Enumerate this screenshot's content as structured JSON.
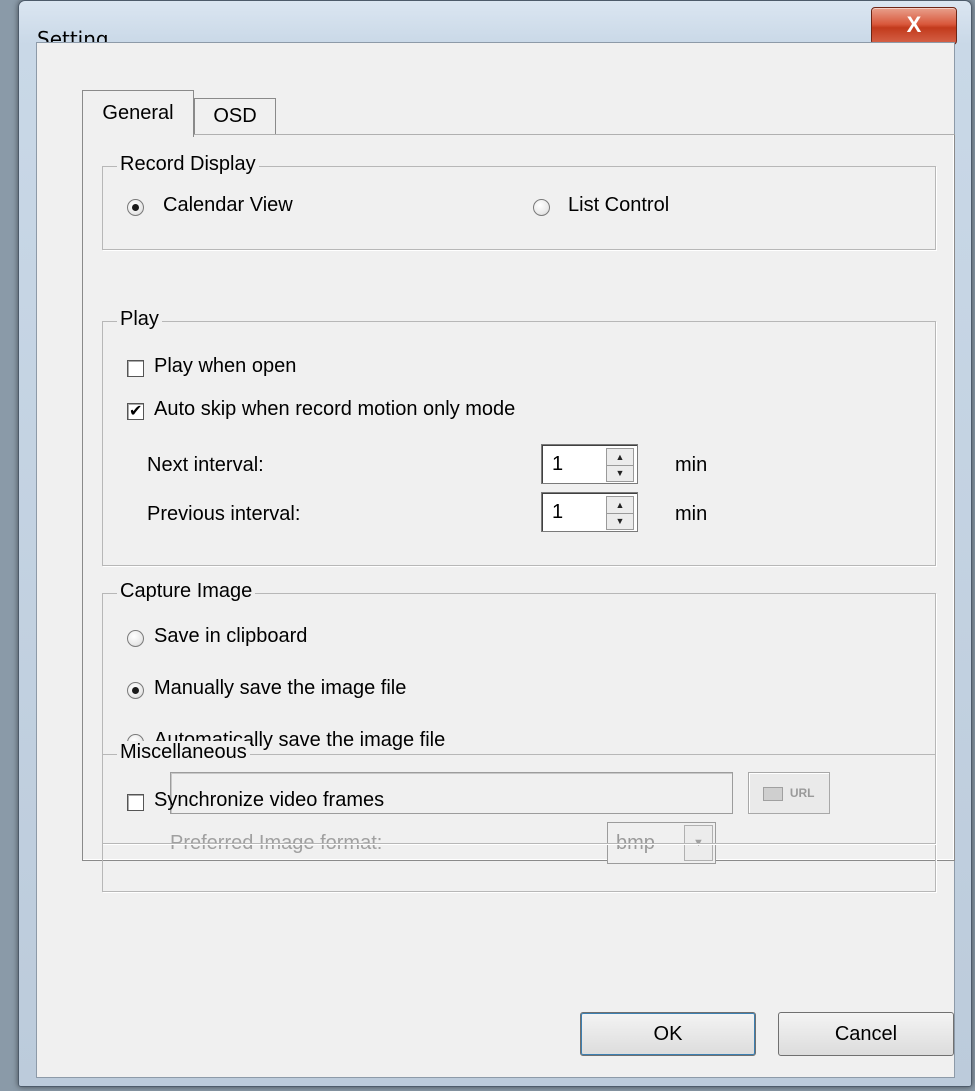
{
  "window": {
    "title": "Setting",
    "close_label": "X"
  },
  "tabs": [
    {
      "label": "General",
      "selected": true
    },
    {
      "label": "OSD",
      "selected": false
    }
  ],
  "record_display": {
    "title": "Record Display",
    "options": [
      {
        "label": "Calendar View",
        "checked": true
      },
      {
        "label": "List Control",
        "checked": false
      }
    ]
  },
  "play": {
    "title": "Play",
    "play_when_open": {
      "label": "Play when open",
      "checked": false
    },
    "auto_skip": {
      "label": "Auto skip when record motion only mode",
      "checked": true
    },
    "next_interval": {
      "label": "Next interval:",
      "value": "1",
      "unit": "min"
    },
    "previous_interval": {
      "label": "Previous interval:",
      "value": "1",
      "unit": "min"
    }
  },
  "capture_image": {
    "title": "Capture Image",
    "options": [
      {
        "label": "Save in clipboard",
        "checked": false
      },
      {
        "label": "Manually save the image file",
        "checked": true
      },
      {
        "label": "Automatically save the image file",
        "checked": false
      }
    ],
    "path_value": "",
    "url_button_label": "URL",
    "format_label": "Preferred Image format:",
    "format_value": "bmp"
  },
  "misc": {
    "title": "Miscellaneous",
    "sync_frames": {
      "label": "Synchronize video frames",
      "checked": false
    }
  },
  "buttons": {
    "ok": "OK",
    "cancel": "Cancel"
  }
}
